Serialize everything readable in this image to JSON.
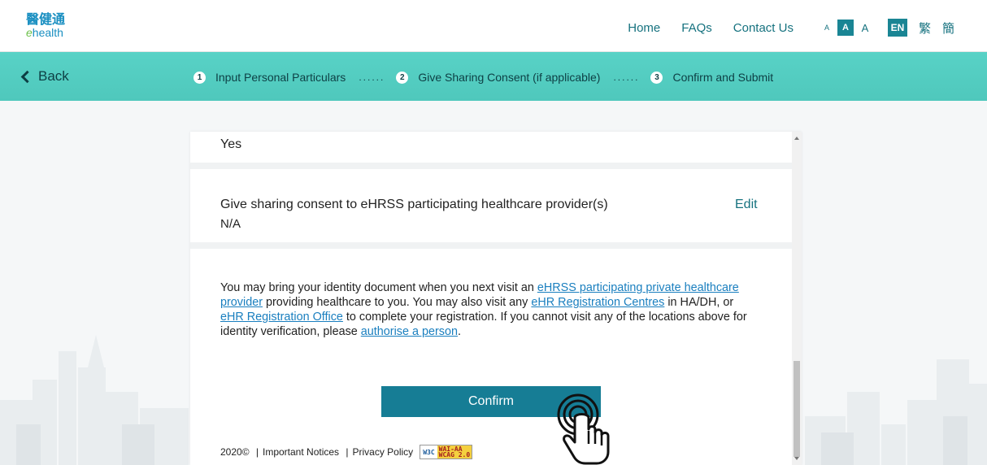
{
  "header": {
    "logo_cn": "醫健通",
    "logo_en_prefix": "e",
    "logo_en_rest": "health",
    "nav": [
      "Home",
      "FAQs",
      "Contact Us"
    ],
    "font_sizes": [
      "A",
      "A",
      "A"
    ],
    "languages": [
      "EN",
      "繁",
      "簡"
    ]
  },
  "stepbar": {
    "back_label": "Back",
    "steps": [
      {
        "num": "1",
        "label": "Input Personal Particulars"
      },
      {
        "num": "2",
        "label": "Give Sharing Consent (if applicable)"
      },
      {
        "num": "3",
        "label": "Confirm and Submit"
      }
    ],
    "separator": "......"
  },
  "card": {
    "prev_answer": "Yes",
    "consent_title": "Give sharing consent to eHRSS participating healthcare provider(s)",
    "consent_value": "N/A",
    "edit_label": "Edit",
    "notice": {
      "t1": "You may bring your identity document when you next visit an ",
      "link1": "eHRSS participating private healthcare provider",
      "t2": " providing healthcare to you. You may also visit any ",
      "link2": "eHR Registration Centres",
      "t3": " in HA/DH, or ",
      "link3": "eHR Registration Office",
      "t4": " to complete your registration. If you cannot visit any of the locations above for identity verification, please ",
      "link4": "authorise a person",
      "t5": "."
    },
    "confirm_label": "Confirm"
  },
  "footer": {
    "copyright": "2020©",
    "important_notices": "Important Notices",
    "privacy_policy": "Privacy Policy",
    "badge_w3c": "W3C",
    "badge_wai": "WAI-AA",
    "badge_wcag": "WCAG 2.0"
  },
  "colors": {
    "accent": "#1a8594",
    "stepbar": "#56cfc3",
    "confirm": "#167d95",
    "link": "#1a7fbf"
  }
}
